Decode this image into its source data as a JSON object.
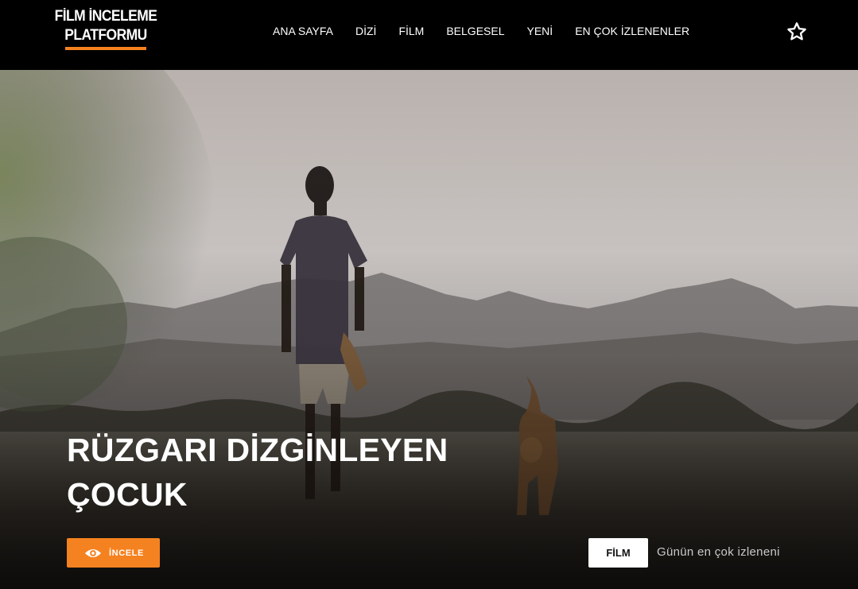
{
  "brand": {
    "line1": "FİLM İNCELEME",
    "line2": "PLATFORMU",
    "accent_color": "#f58220"
  },
  "nav": {
    "items": [
      {
        "label": "ANA SAYFA"
      },
      {
        "label": "DİZİ"
      },
      {
        "label": "FİLM"
      },
      {
        "label": "BELGESEL"
      },
      {
        "label": "YENİ"
      },
      {
        "label": "EN ÇOK İZLENENLER"
      }
    ],
    "favorites_icon": "star-outline-icon"
  },
  "hero": {
    "title_line1": "RÜZGARI DİZGİNLEYEN",
    "title_line2": "ÇOCUK",
    "review_button": {
      "label": "İNCELE",
      "icon": "eye-icon"
    },
    "category": "FİLM",
    "caption": "Günün en çok izleneni"
  }
}
